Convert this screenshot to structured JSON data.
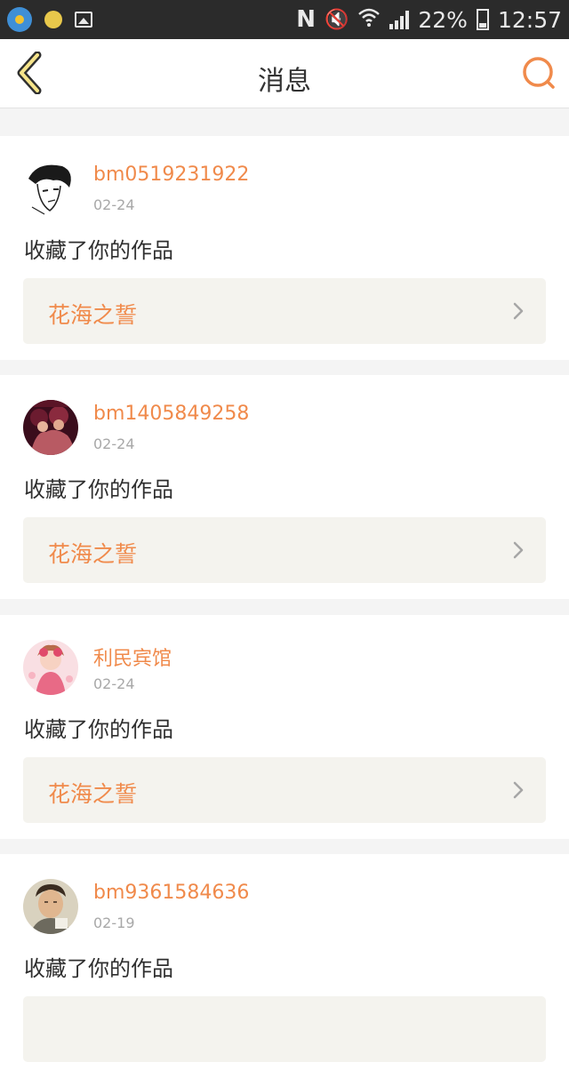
{
  "status_bar": {
    "network_letter": "N",
    "battery_percent": "22%",
    "time": "12:57"
  },
  "nav": {
    "title": "消息",
    "accent_color": "#f08a4b",
    "back_icon": "chevron-left-icon",
    "search_icon": "search-icon"
  },
  "notifications": [
    {
      "user": "bm0519231922",
      "date": "02-24",
      "action": "收藏了你的作品",
      "work_title": "花海之誓"
    },
    {
      "user": "bm1405849258",
      "date": "02-24",
      "action": "收藏了你的作品",
      "work_title": "花海之誓"
    },
    {
      "user": "利民宾馆",
      "date": "02-24",
      "action": "收藏了你的作品",
      "work_title": "花海之誓"
    },
    {
      "user": "bm9361584636",
      "date": "02-19",
      "action": "收藏了你的作品",
      "work_title": ""
    }
  ]
}
